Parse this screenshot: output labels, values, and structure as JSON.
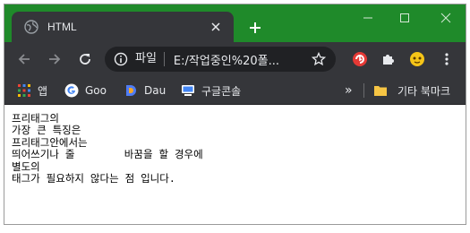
{
  "tab": {
    "title": "HTML",
    "favicon": "globe-icon"
  },
  "window_controls": {
    "minimize": "minimize-icon",
    "maximize": "maximize-icon",
    "close": "close-icon"
  },
  "omnibox": {
    "chip": "파일",
    "url": "E:/작업중인%20폴..."
  },
  "bookmarks": [
    {
      "label": "앱",
      "icon": "apps-grid-icon"
    },
    {
      "label": "Goo",
      "icon": "google-icon"
    },
    {
      "label": "Dau",
      "icon": "daum-icon"
    },
    {
      "label": "구글콘솔",
      "icon": "console-icon"
    }
  ],
  "bookmarks_overflow": "»",
  "other_bookmarks": {
    "label": "기타 북마크",
    "icon": "folder-icon"
  },
  "content": {
    "lines": [
      "프리태그의",
      "가장 큰 특징은",
      "프리태그안에서는",
      "띄어쓰기나 줄        바꿈을 할 경우에",
      "별도의",
      "태그가 필요하지 않다는 점 입니다."
    ]
  },
  "colors": {
    "titlebar": "#1f8a2a",
    "toolbar": "#35363a",
    "omnibox": "#202124",
    "text_light": "#e8eaed"
  }
}
